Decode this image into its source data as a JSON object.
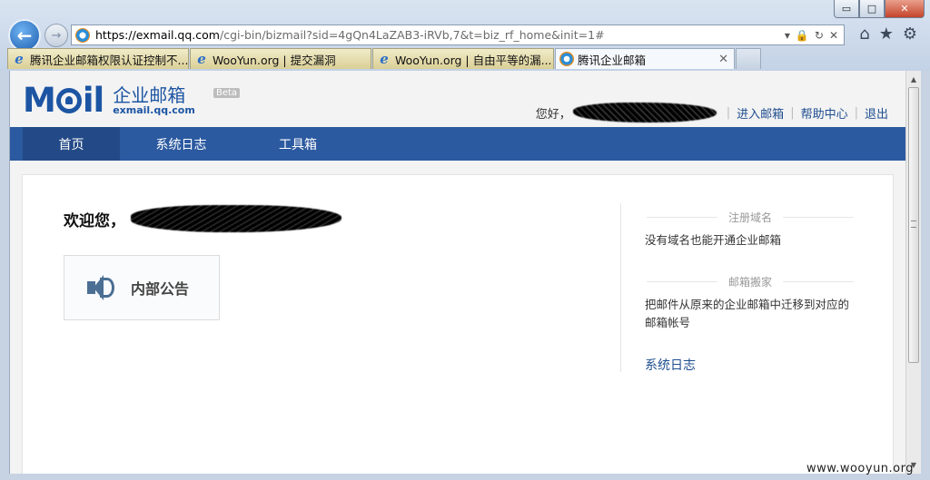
{
  "browser": {
    "url_host": "https://exmail.qq.com",
    "url_rest": "/cgi-bin/bizmail?sid=4gQn4LaZAB3-iRVb,7&t=biz_rf_home&init=1#",
    "window_buttons": {
      "minimize": "▭",
      "maximize": "□",
      "close": "✕"
    },
    "tabs": [
      {
        "label": "腾讯企业邮箱权限认证控制不...",
        "icon": "ie-icon"
      },
      {
        "label": "WooYun.org | 提交漏洞",
        "icon": "ie-icon"
      },
      {
        "label": "WooYun.org | 自由平等的漏...",
        "icon": "ie-icon"
      },
      {
        "label": "腾讯企业邮箱",
        "icon": "qq-mail-icon",
        "active": true
      }
    ]
  },
  "header": {
    "logo_cn": "企业邮箱",
    "logo_domain": "exmail.qq.com",
    "logo_beta": "Beta",
    "greeting": "您好，",
    "links": [
      "进入邮箱",
      "帮助中心",
      "退出"
    ]
  },
  "nav": {
    "items": [
      "首页",
      "系统日志",
      "工具箱"
    ],
    "active_index": 0
  },
  "main": {
    "welcome": "欢迎您，",
    "notice_label": "内部公告"
  },
  "side": {
    "sections": [
      {
        "title": "注册域名",
        "text": "没有域名也能开通企业邮箱"
      },
      {
        "title": "邮箱搬家",
        "text": "把邮件从原来的企业邮箱中迁移到对应的邮箱帐号"
      }
    ],
    "link": "系统日志"
  },
  "watermark": "www.wooyun.org",
  "colors": {
    "brand": "#1c55a3",
    "nav_bg": "#2c5aa0",
    "nav_active": "#234a87",
    "link": "#1e4e8f"
  }
}
